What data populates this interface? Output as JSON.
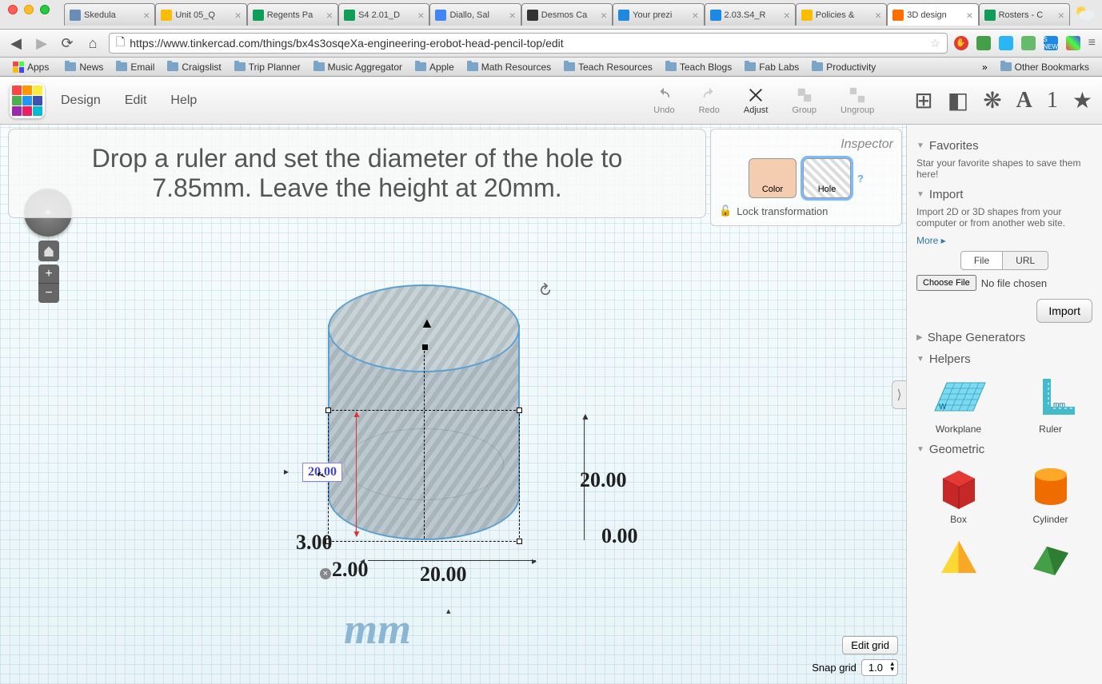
{
  "browser": {
    "tabs": [
      {
        "title": "Skedula",
        "favicon": "#6a8db5"
      },
      {
        "title": "Unit 05_Q",
        "favicon": "#fbbc04"
      },
      {
        "title": "Regents Pa",
        "favicon": "#0f9d58"
      },
      {
        "title": "S4 2.01_D",
        "favicon": "#0f9d58"
      },
      {
        "title": "Diallo, Sal",
        "favicon": "#4285f4"
      },
      {
        "title": "Desmos Ca",
        "favicon": "#333333"
      },
      {
        "title": "Your prezi",
        "favicon": "#1e88e5"
      },
      {
        "title": "2.03.S4_R",
        "favicon": "#1e88e5"
      },
      {
        "title": "Policies &",
        "favicon": "#fbbc04"
      },
      {
        "title": "3D design",
        "favicon": "#ff6f00",
        "active": true
      },
      {
        "title": "Rosters - C",
        "favicon": "#0f9d58"
      }
    ],
    "url": "https://www.tinkercad.com/things/bx4s3osqeXa-engineering-erobot-head-pencil-top/edit",
    "bookmarks": [
      "Apps",
      "News",
      "Email",
      "Craigslist",
      "Trip Planner",
      "Music Aggregator",
      "Apple",
      "Math Resources",
      "Teach Resources",
      "Teach Blogs",
      "Fab Labs",
      "Productivity"
    ],
    "other_bookmarks": "Other Bookmarks",
    "more_arrow": "»"
  },
  "app": {
    "menu": [
      "Design",
      "Edit",
      "Help"
    ],
    "tools": {
      "undo": "Undo",
      "redo": "Redo",
      "adjust": "Adjust",
      "group": "Group",
      "ungroup": "Ungroup"
    }
  },
  "instruction": "Drop a ruler and set the diameter of the hole to 7.85mm.  Leave the height at 20mm.",
  "inspector": {
    "title": "Inspector",
    "color": "Color",
    "hole": "Hole",
    "help": "?",
    "lock": "Lock transformation"
  },
  "dimensions": {
    "editing": "20.00",
    "right_height": "20.00",
    "right_base": "0.00",
    "left_base": "3.00",
    "origin_x": "2.00",
    "bottom_width": "20.00",
    "unit": "mm"
  },
  "grid": {
    "edit": "Edit grid",
    "snap_label": "Snap grid",
    "snap_value": "1.0"
  },
  "sidebar": {
    "favorites": {
      "title": "Favorites",
      "body": "Star your favorite shapes to save them here!"
    },
    "import": {
      "title": "Import",
      "body": "Import 2D or 3D shapes from your computer or from another web site.",
      "more": "More ▸",
      "tab_file": "File",
      "tab_url": "URL",
      "choose": "Choose File",
      "nofile": "No file chosen",
      "btn": "Import"
    },
    "generators": {
      "title": "Shape Generators"
    },
    "helpers": {
      "title": "Helpers",
      "workplane": "Workplane",
      "ruler": "Ruler"
    },
    "geometric": {
      "title": "Geometric",
      "box": "Box",
      "cylinder": "Cylinder"
    }
  }
}
